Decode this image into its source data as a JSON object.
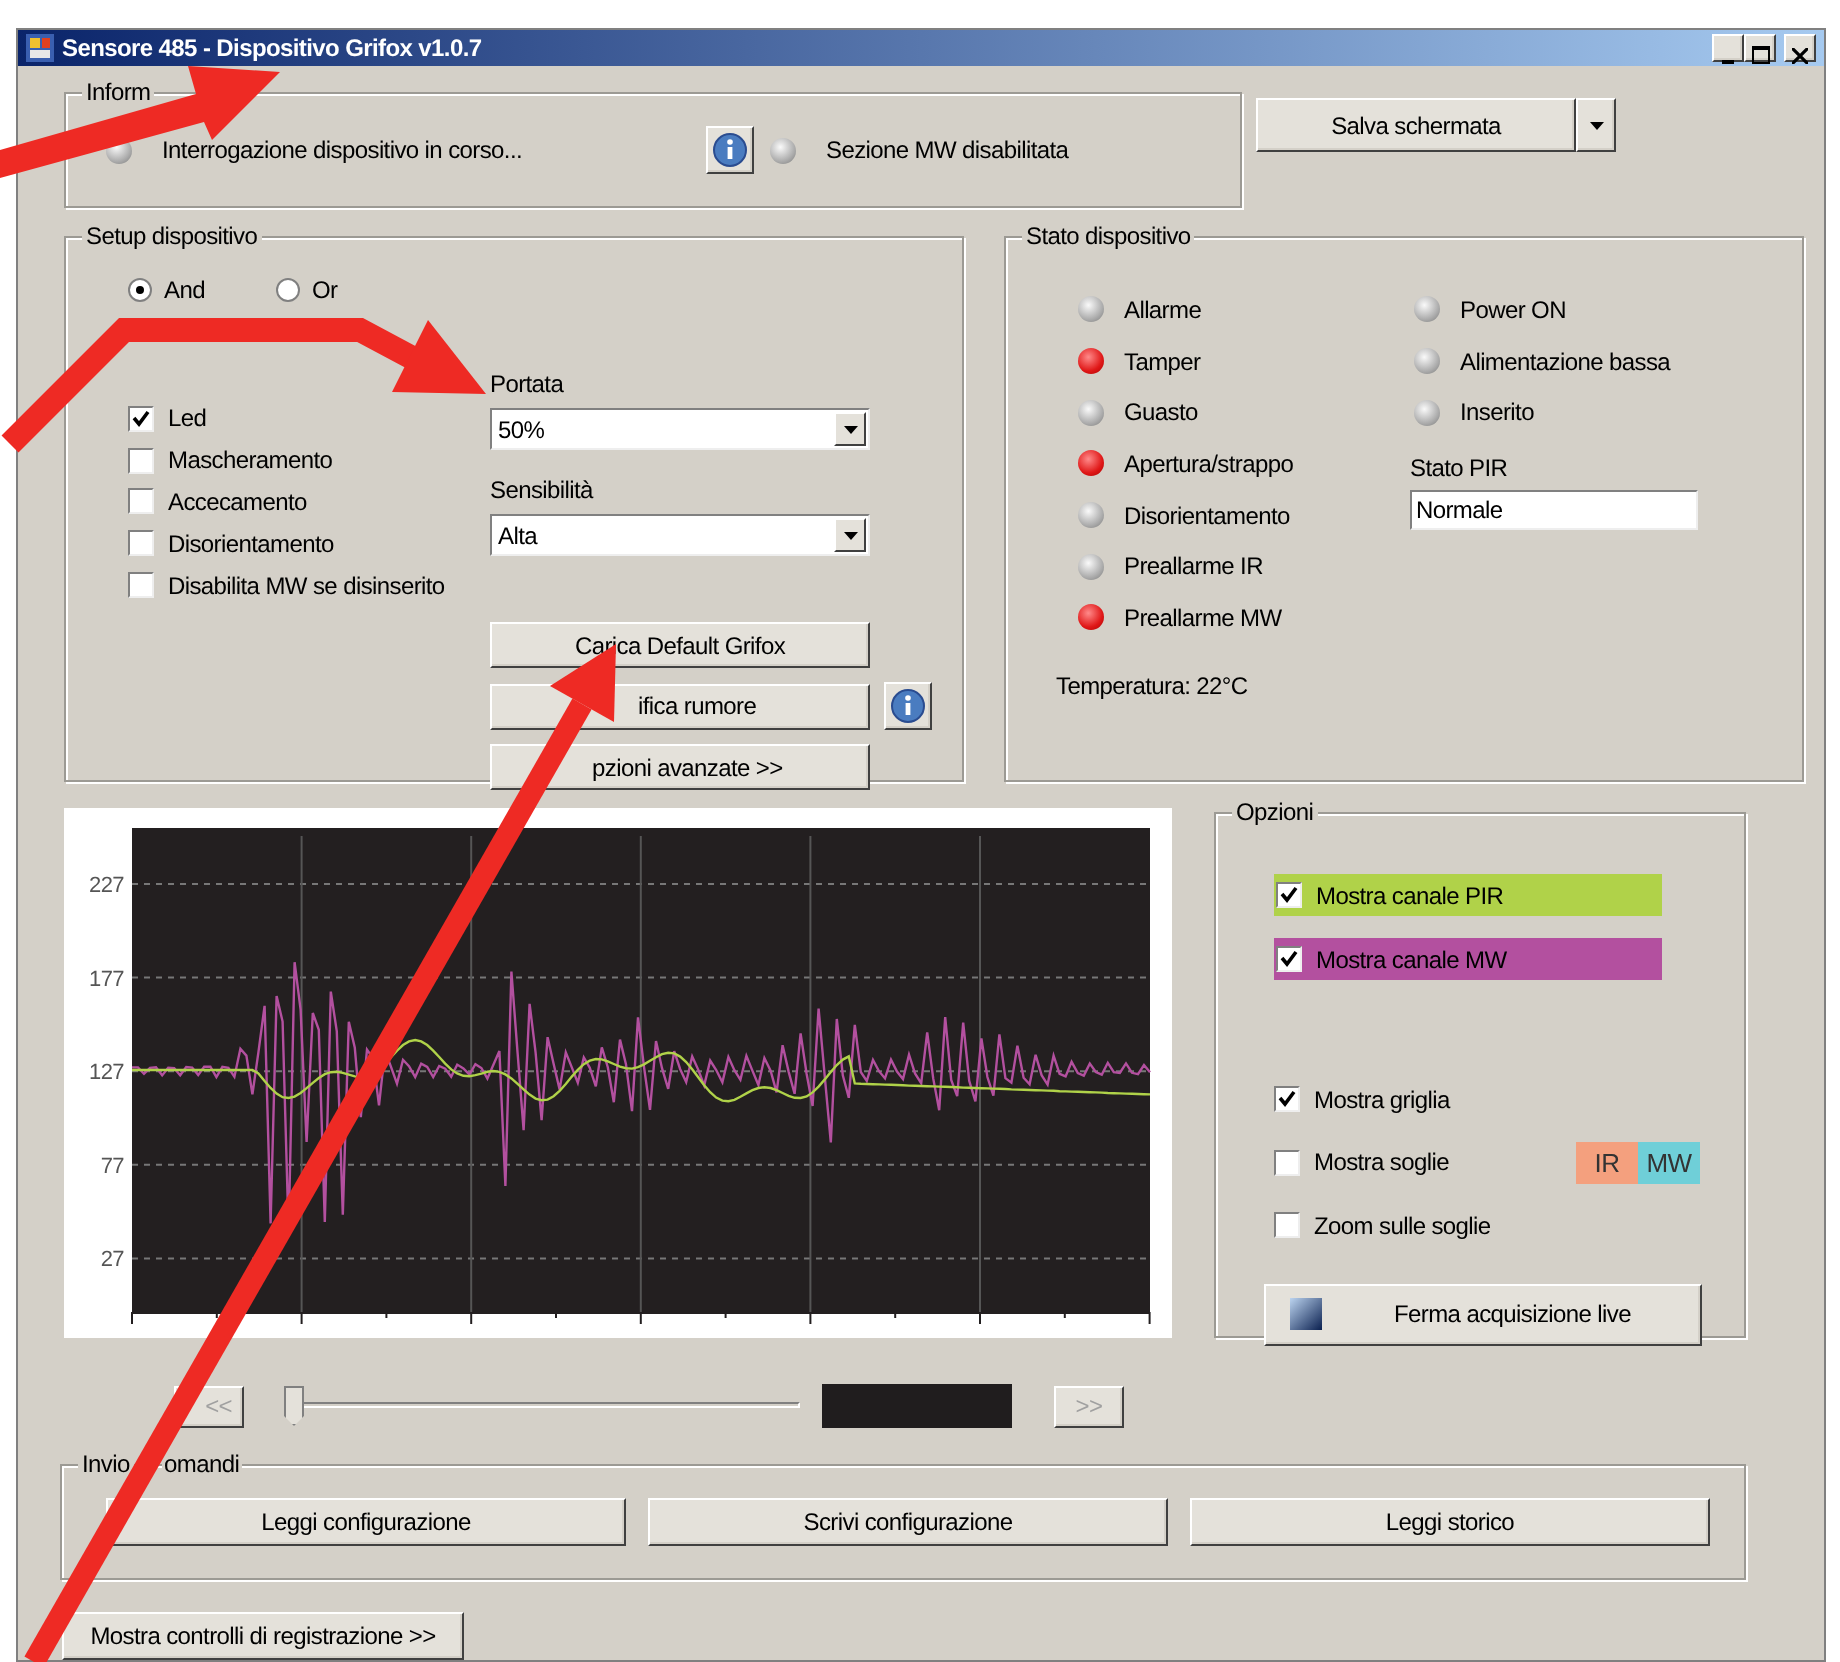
{
  "window": {
    "title": "Sensore 485 - Dispositivo Grifox v1.0.7"
  },
  "info": {
    "label": "Inform",
    "items": [
      {
        "text": "Interrogazione dispositivo in corso...",
        "on": false
      },
      {
        "text": "Sezione MW disabilitata",
        "on": false
      }
    ]
  },
  "save_button": {
    "label": "Salva schermata"
  },
  "setup": {
    "label": "Setup dispositivo",
    "logic": [
      {
        "label": "And",
        "selected": true
      },
      {
        "label": "Or",
        "selected": false
      }
    ],
    "checks": [
      {
        "label": "Led",
        "checked": true
      },
      {
        "label": "Mascheramento",
        "checked": false
      },
      {
        "label": "Accecamento",
        "checked": false
      },
      {
        "label": "Disorientamento",
        "checked": false
      },
      {
        "label": "Disabilita MW se disinserito",
        "checked": false
      }
    ],
    "portata": {
      "label": "Portata",
      "value": "50%"
    },
    "sensibilita": {
      "label": "Sensibilità",
      "value": "Alta"
    },
    "buttons": [
      {
        "label": "Carica Default Grifox",
        "info": false
      },
      {
        "label": "ifica rumore",
        "info": true
      },
      {
        "label": "pzioni avanzate >>",
        "info": false
      }
    ]
  },
  "status": {
    "label": "Stato dispositivo",
    "left": [
      {
        "text": "Allarme",
        "on": false
      },
      {
        "text": "Tamper",
        "on": true
      },
      {
        "text": "Guasto",
        "on": false
      },
      {
        "text": "Apertura/strappo",
        "on": true
      },
      {
        "text": "Disorientamento",
        "on": false
      },
      {
        "text": "Preallarme IR",
        "on": false
      },
      {
        "text": "Preallarme MW",
        "on": true
      }
    ],
    "right": [
      {
        "text": "Power ON",
        "on": false
      },
      {
        "text": "Alimentazione bassa",
        "on": false
      },
      {
        "text": "Inserito",
        "on": false
      }
    ],
    "temperature": "Temperatura: 22°C",
    "pir": {
      "label": "Stato PIR",
      "value": "Normale"
    }
  },
  "chart": {
    "y_tick_labels": [
      "227",
      "177",
      "127",
      "77",
      "27"
    ]
  },
  "options": {
    "label": "Opzioni",
    "channels": [
      {
        "label": "Mostra canale PIR",
        "checked": true,
        "color": "#b0d249"
      },
      {
        "label": "Mostra canale MW",
        "checked": true,
        "color": "#b3509f"
      }
    ],
    "checks": [
      {
        "label": "Mostra griglia",
        "checked": true
      },
      {
        "label": "Mostra soglie",
        "checked": false
      },
      {
        "label": "Zoom sulle soglie",
        "checked": false
      }
    ],
    "thresholds": [
      {
        "label": "IR",
        "color": "#f4a07e"
      },
      {
        "label": "MW",
        "color": "#6fcfd8"
      }
    ],
    "stop_button": {
      "label": "Ferma acquisizione live"
    }
  },
  "playback": {
    "prev": "<<",
    "next": ">>",
    "disabled": true,
    "level": 0
  },
  "commands": {
    "label": "Invio",
    "label_2": "omandi",
    "buttons": [
      "Leggi configurazione",
      "Scrivi configurazione",
      "Leggi storico"
    ]
  },
  "record_button": {
    "label": "Mostra controlli di registrazione >>"
  }
}
